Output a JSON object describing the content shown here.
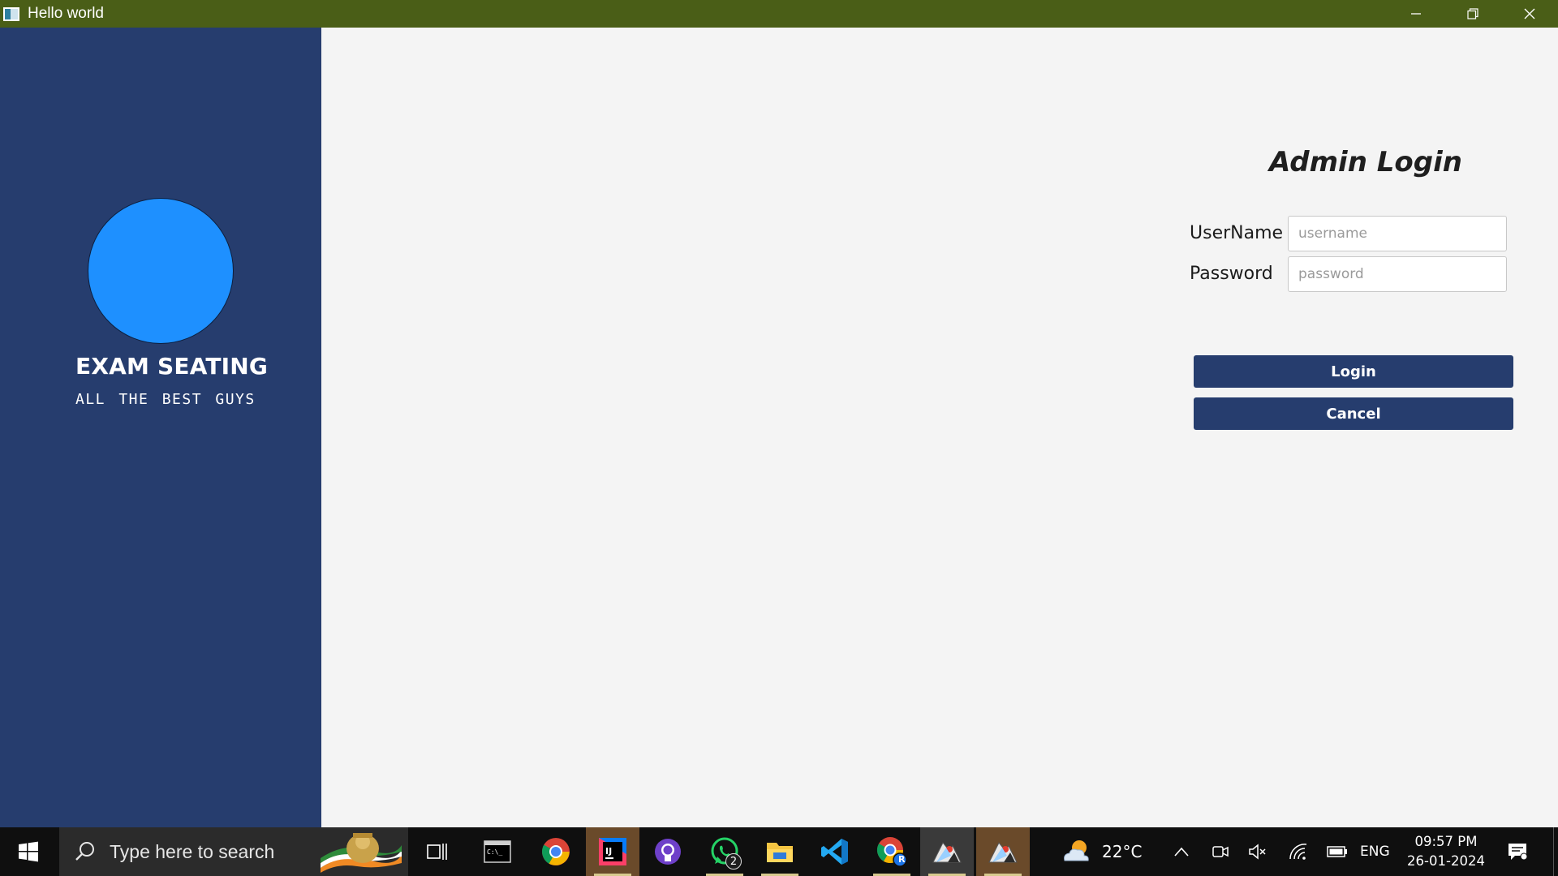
{
  "window": {
    "title": "Hello world",
    "controls": {
      "minimize": "minimize",
      "restore": "restore",
      "close": "close"
    }
  },
  "sidebar": {
    "title": "EXAM SEATING",
    "subtitle": "ALL THE BEST GUYS",
    "avatar_color": "#1e90ff",
    "background": "#263d6e"
  },
  "login": {
    "title": "Admin Login",
    "username_label": "UserName",
    "username_placeholder": "username",
    "username_value": "",
    "password_label": "Password",
    "password_placeholder": "password",
    "password_value": "",
    "login_button": "Login",
    "cancel_button": "Cancel"
  },
  "taskbar": {
    "search_placeholder": "Type here to search",
    "apps": [
      {
        "name": "Task View",
        "icon": "task-view-icon"
      },
      {
        "name": "Command Prompt",
        "icon": "terminal-icon"
      },
      {
        "name": "Google Chrome",
        "icon": "chrome-icon"
      },
      {
        "name": "IntelliJ IDEA",
        "icon": "intellij-icon"
      },
      {
        "name": "GitHub Desktop",
        "icon": "github-icon"
      },
      {
        "name": "WhatsApp",
        "icon": "whatsapp-icon",
        "badge": "2"
      },
      {
        "name": "File Explorer",
        "icon": "folder-icon"
      },
      {
        "name": "Visual Studio Code",
        "icon": "vscode-icon"
      },
      {
        "name": "Chrome Profile",
        "icon": "chrome-profile-icon",
        "profile_letter": "R"
      },
      {
        "name": "Java App 1",
        "icon": "java-icon"
      },
      {
        "name": "Java App 2",
        "icon": "java-icon"
      }
    ],
    "weather": {
      "temperature": "22°C",
      "icon": "partly-cloudy-icon"
    },
    "tray": {
      "language": "ENG",
      "icons": [
        "chevron-up-icon",
        "meet-now-icon",
        "volume-muted-icon",
        "wifi-icon",
        "battery-icon"
      ]
    },
    "clock": {
      "time": "09:57 PM",
      "date": "26-01-2024"
    }
  }
}
